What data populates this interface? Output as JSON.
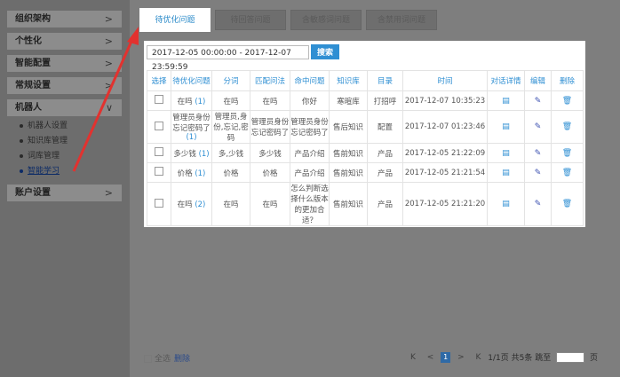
{
  "sidebar": {
    "menus": [
      {
        "label": "组织架构",
        "chevron": ">"
      },
      {
        "label": "个性化",
        "chevron": ">"
      },
      {
        "label": "智能配置",
        "chevron": ">"
      },
      {
        "label": "常规设置",
        "chevron": ">"
      },
      {
        "label": "机器人",
        "chevron": "∨"
      },
      {
        "label": "账户设置",
        "chevron": ">"
      }
    ],
    "robot_sub": [
      {
        "label": "机器人设置"
      },
      {
        "label": "知识库管理"
      },
      {
        "label": "词库管理"
      },
      {
        "label": "智能学习"
      }
    ]
  },
  "tabs": [
    {
      "label": "待优化问题"
    },
    {
      "label": "待回答问题"
    },
    {
      "label": "含敏感词问题"
    },
    {
      "label": "含禁用词问题"
    }
  ],
  "filter": {
    "date_range": "2017-12-05 00:00:00 - 2017-12-07 23:59:59",
    "search_label": "搜索"
  },
  "table": {
    "headers": [
      "选择",
      "待优化问题",
      "分词",
      "匹配问法",
      "命中问题",
      "知识库",
      "目录",
      "时间",
      "对话详情",
      "编辑",
      "删除"
    ],
    "rows": [
      {
        "question": "在吗",
        "count": "(1)",
        "segment": "在吗",
        "match": "在吗",
        "hit": "你好",
        "kb": "寒暄库",
        "dir": "打招呼",
        "time": "2017-12-07 10:35:23"
      },
      {
        "question": "管理员身份忘记密码了",
        "count": "(1)",
        "segment": "管理员,身份,忘记,密码",
        "match": "管理员身份忘记密码了",
        "hit": "管理员身份忘记密码了",
        "kb": "售后知识",
        "dir": "配置",
        "time": "2017-12-07 01:23:46"
      },
      {
        "question": "多少钱",
        "count": "(1)",
        "segment": "多,少钱",
        "match": "多少钱",
        "hit": "产品介绍",
        "kb": "售前知识",
        "dir": "产品",
        "time": "2017-12-05 21:22:09"
      },
      {
        "question": "价格",
        "count": "(1)",
        "segment": "价格",
        "match": "价格",
        "hit": "产品介绍",
        "kb": "售前知识",
        "dir": "产品",
        "time": "2017-12-05 21:21:54"
      },
      {
        "question": "在吗",
        "count": "(2)",
        "segment": "在吗",
        "match": "在吗",
        "hit": "怎么判断选择什么版本的更加合适？",
        "kb": "售前知识",
        "dir": "产品",
        "time": "2017-12-05 21:21:20"
      }
    ]
  },
  "footer": {
    "select_all": "全选",
    "delete": "删除",
    "first": "K",
    "prev": "<",
    "current_page": "1",
    "next": ">",
    "last": "K",
    "page_info": "1/1页 共5条 跳至",
    "page_unit": "页"
  },
  "colors": {
    "accent": "#2f8fd3",
    "arrow": "#e2322f"
  }
}
